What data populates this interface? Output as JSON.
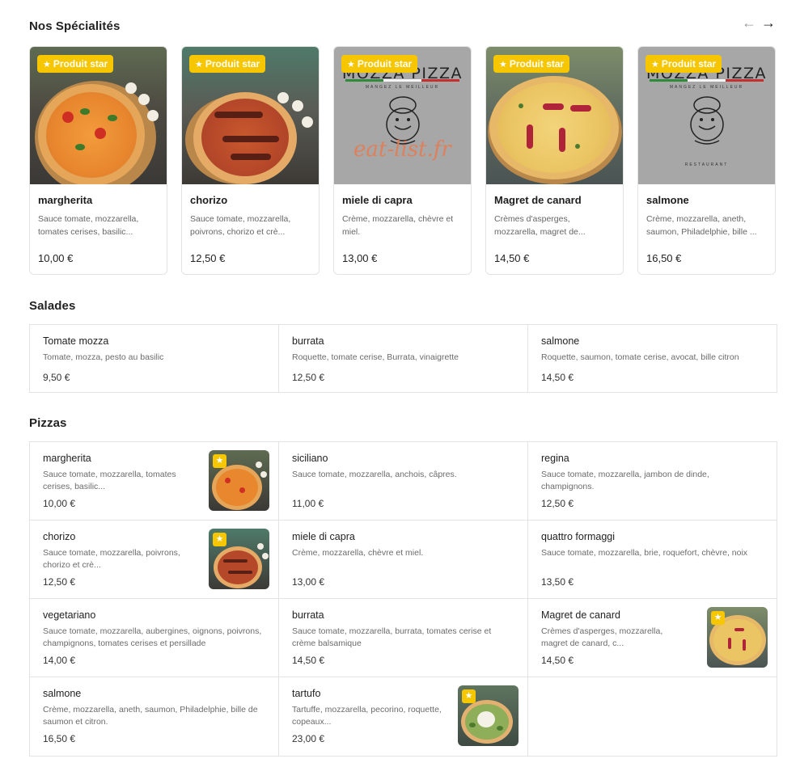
{
  "specialties": {
    "title": "Nos Spécialités",
    "prev_arrow": "←",
    "next_arrow": "→",
    "badge_label": "Produit star",
    "items": [
      {
        "name": "margherita",
        "desc": "Sauce tomate, mozzarella, tomates cerises, basilic...",
        "price": "10,00 €",
        "image": "pizza-margherita"
      },
      {
        "name": "chorizo",
        "desc": "Sauce tomate, mozzarella, poivrons, chorizo et crè...",
        "price": "12,50 €",
        "image": "pizza-chorizo"
      },
      {
        "name": "miele di capra",
        "desc": "Crème, mozzarella, chèvre et miel.",
        "price": "13,00 €",
        "image": "restaurant-logo"
      },
      {
        "name": "Magret de canard",
        "desc": "Crèmes d'asperges, mozzarella, magret de...",
        "price": "14,50 €",
        "image": "pizza-magret"
      },
      {
        "name": "salmone",
        "desc": "Crème, mozzarella, aneth, saumon, Philadelphie, bille ...",
        "price": "16,50 €",
        "image": "restaurant-logo"
      }
    ],
    "logo": {
      "title": "MOZZA PIZZA",
      "subtitle": "MANGEZ LE MEILLEUR",
      "footer": "RESTAURANT"
    },
    "watermark": "eat-list.fr"
  },
  "salades": {
    "title": "Salades",
    "items": [
      {
        "name": "Tomate mozza",
        "desc": "Tomate, mozza, pesto au basilic",
        "price": "9,50 €"
      },
      {
        "name": "burrata",
        "desc": "Roquette, tomate cerise, Burrata, vinaigrette",
        "price": "12,50 €"
      },
      {
        "name": "salmone",
        "desc": "Roquette, saumon, tomate cerise, avocat, bille citron",
        "price": "14,50 €"
      }
    ]
  },
  "pizzas": {
    "title": "Pizzas",
    "star_glyph": "★",
    "items": [
      {
        "name": "margherita",
        "desc": "Sauce tomate, mozzarella, tomates cerises, basilic...",
        "price": "10,00 €",
        "thumb": "pizza-margherita"
      },
      {
        "name": "siciliano",
        "desc": "Sauce tomate, mozzarella, anchois, câpres.",
        "price": "11,00 €"
      },
      {
        "name": "regina",
        "desc": "Sauce tomate, mozzarella, jambon de dinde, champignons.",
        "price": "12,50 €"
      },
      {
        "name": "chorizo",
        "desc": "Sauce tomate, mozzarella, poivrons, chorizo et crè...",
        "price": "12,50 €",
        "thumb": "pizza-chorizo"
      },
      {
        "name": "miele di capra",
        "desc": "Crème, mozzarella, chèvre et miel.",
        "price": "13,00 €"
      },
      {
        "name": "quattro formaggi",
        "desc": "Sauce tomate, mozzarella, brie, roquefort, chèvre, noix",
        "price": "13,50 €"
      },
      {
        "name": "vegetariano",
        "desc": "Sauce tomate, mozzarella, aubergines, oignons, poivrons, champignons, tomates cerises et persillade",
        "price": "14,00 €"
      },
      {
        "name": "burrata",
        "desc": "Sauce tomate, mozzarella, burrata, tomates cerise et crème balsamique",
        "price": "14,50 €"
      },
      {
        "name": "Magret de canard",
        "desc": "Crèmes d'asperges, mozzarella, magret de canard, c...",
        "price": "14,50 €",
        "thumb": "pizza-magret"
      },
      {
        "name": "salmone",
        "desc": "Crème, mozzarella, aneth, saumon, Philadelphie, bille de saumon et citron.",
        "price": "16,50 €"
      },
      {
        "name": "tartufo",
        "desc": "Tartuffe, mozzarella, pecorino, roquette, copeaux...",
        "price": "23,00 €",
        "thumb": "pizza-tartufo"
      }
    ]
  },
  "colors": {
    "badge": "#f6c600",
    "border": "#e3e3e3",
    "watermark": "#e87a50"
  }
}
